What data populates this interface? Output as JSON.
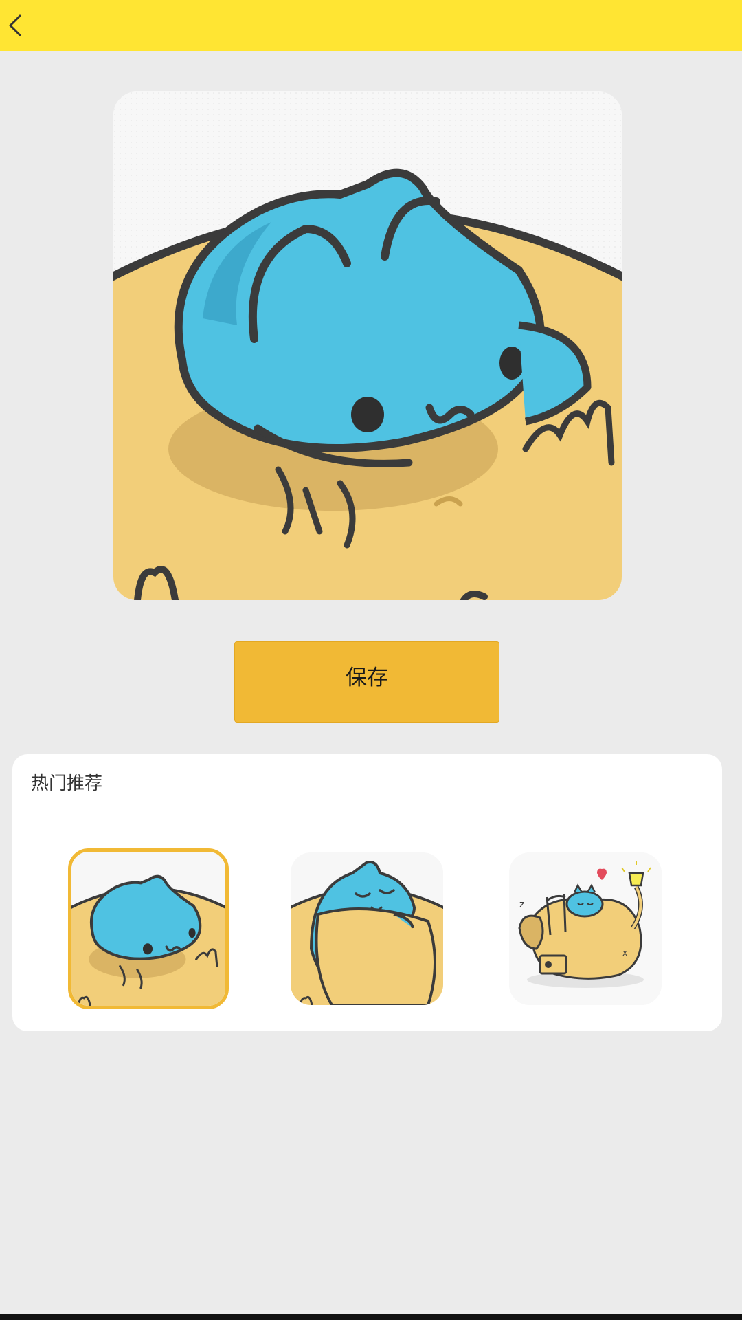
{
  "header": {
    "back_icon": "chevron-left-icon",
    "background_color": "#ffe533"
  },
  "preview": {
    "image": "blue-cat-in-bowl-illustration"
  },
  "actions": {
    "save_label": "保存",
    "save_color": "#f1b935"
  },
  "recommendations": {
    "title": "热门推荐",
    "items": [
      {
        "image": "blue-cat-in-bowl-illustration",
        "selected": true
      },
      {
        "image": "blue-cat-sleeping-on-bread-illustration",
        "selected": false
      },
      {
        "image": "blue-cat-sleeping-on-dog-illustration",
        "selected": false
      }
    ]
  }
}
